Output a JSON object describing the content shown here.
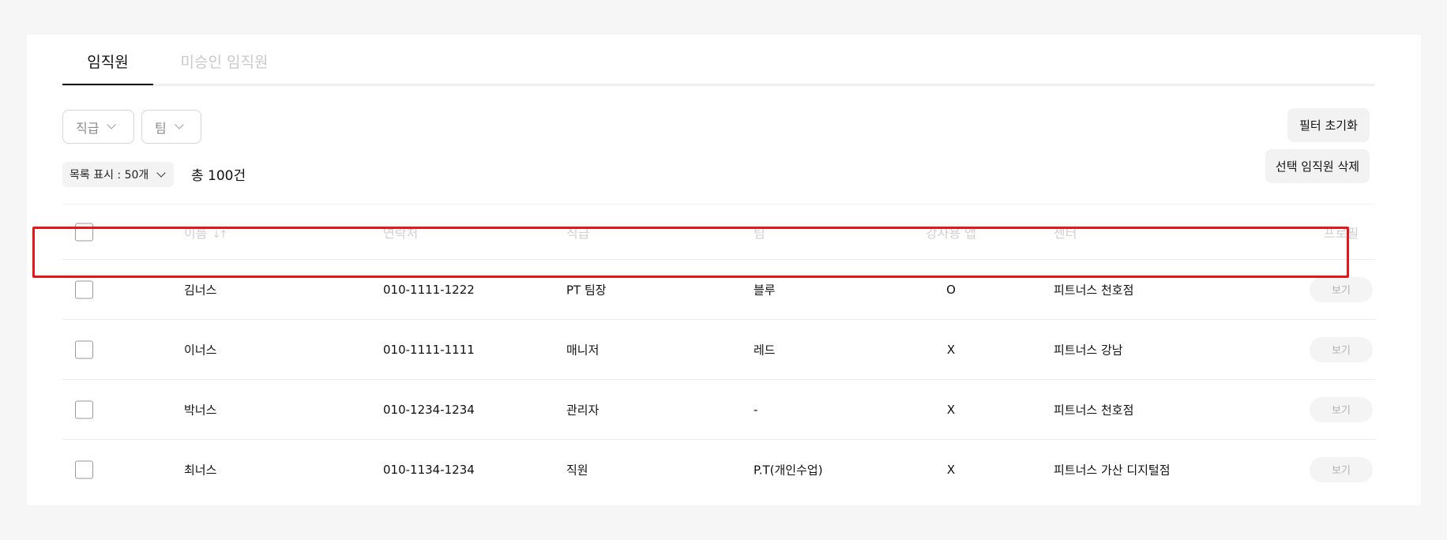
{
  "tabs": [
    {
      "label": "임직원",
      "active": true
    },
    {
      "label": "미승인 임직원",
      "active": false
    }
  ],
  "filters": {
    "rank_label": "직급",
    "team_label": "팀",
    "page_size": "목록 표시 : 50개",
    "total": "총 100건"
  },
  "actions": {
    "reset": "필터 초기화",
    "delete_selected": "선택 임직원 삭제"
  },
  "table": {
    "headers": {
      "name": "이름",
      "sort_icon": "↓↑",
      "phone": "연락처",
      "rank": "직급",
      "team": "팀",
      "app": "강사용 앱",
      "center": "센터",
      "profile": "프로필"
    },
    "rows": [
      {
        "name": "김너스",
        "phone": "010-1111-1222",
        "rank": "PT 팀장",
        "team": "블루",
        "app": "O",
        "center": "피트너스 천호점",
        "profile": "보기",
        "highlighted": true
      },
      {
        "name": "이너스",
        "phone": "010-1111-1111",
        "rank": "매니저",
        "team": "레드",
        "app": "X",
        "center": "피트너스 강남",
        "profile": "보기"
      },
      {
        "name": "박너스",
        "phone": "010-1234-1234",
        "rank": "관리자",
        "team": "-",
        "app": "X",
        "center": "피트너스 천호점",
        "profile": "보기"
      },
      {
        "name": "최너스",
        "phone": "010-1134-1234",
        "rank": "직원",
        "team": "P.T(개인수업)",
        "app": "X",
        "center": "피트너스 가산 디지털점",
        "profile": "보기"
      }
    ]
  },
  "colors": {
    "highlight": "#e8161b",
    "background": "#f6f6f6",
    "card": "#ffffff"
  }
}
